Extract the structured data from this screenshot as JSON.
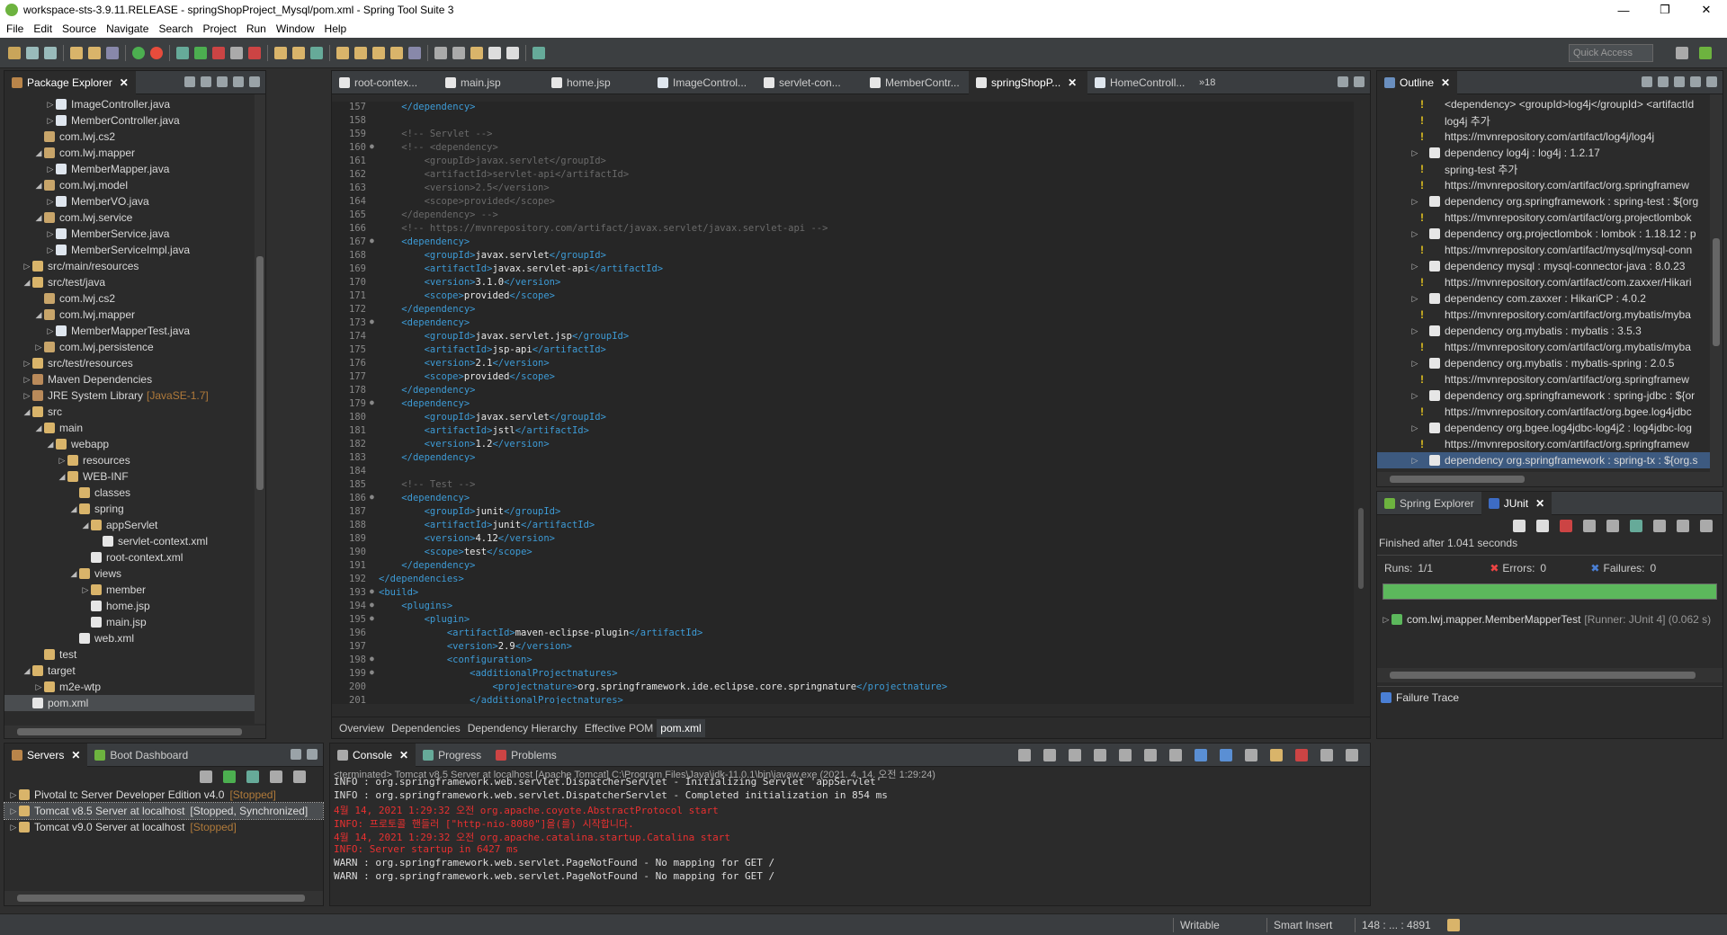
{
  "window": {
    "title": "workspace-sts-3.9.11.RELEASE - springShopProject_Mysql/pom.xml - Spring Tool Suite 3"
  },
  "menu": [
    "File",
    "Edit",
    "Source",
    "Navigate",
    "Search",
    "Project",
    "Run",
    "Window",
    "Help"
  ],
  "toolbar": {
    "quick_access_placeholder": "Quick Access"
  },
  "package_explorer": {
    "title": "Package Explorer",
    "items": [
      {
        "label": "ImageController.java",
        "depth": 3,
        "tw": "▷",
        "icon": "java-file-icon"
      },
      {
        "label": "MemberController.java",
        "depth": 3,
        "tw": "▷",
        "icon": "java-file-icon"
      },
      {
        "label": "com.lwj.cs2",
        "depth": 2,
        "tw": "",
        "icon": "package-icon"
      },
      {
        "label": "com.lwj.mapper",
        "depth": 2,
        "tw": "◢",
        "icon": "package-icon"
      },
      {
        "label": "MemberMapper.java",
        "depth": 3,
        "tw": "▷",
        "icon": "java-file-icon"
      },
      {
        "label": "com.lwj.model",
        "depth": 2,
        "tw": "◢",
        "icon": "package-icon"
      },
      {
        "label": "MemberVO.java",
        "depth": 3,
        "tw": "▷",
        "icon": "java-file-icon"
      },
      {
        "label": "com.lwj.service",
        "depth": 2,
        "tw": "◢",
        "icon": "package-icon"
      },
      {
        "label": "MemberService.java",
        "depth": 3,
        "tw": "▷",
        "icon": "java-file-icon"
      },
      {
        "label": "MemberServiceImpl.java",
        "depth": 3,
        "tw": "▷",
        "icon": "java-file-icon"
      },
      {
        "label": "src/main/resources",
        "depth": 1,
        "tw": "▷",
        "icon": "folder-icon"
      },
      {
        "label": "src/test/java",
        "depth": 1,
        "tw": "◢",
        "icon": "folder-icon"
      },
      {
        "label": "com.lwj.cs2",
        "depth": 2,
        "tw": "",
        "icon": "package-icon"
      },
      {
        "label": "com.lwj.mapper",
        "depth": 2,
        "tw": "◢",
        "icon": "package-icon"
      },
      {
        "label": "MemberMapperTest.java",
        "depth": 3,
        "tw": "▷",
        "icon": "java-file-icon"
      },
      {
        "label": "com.lwj.persistence",
        "depth": 2,
        "tw": "▷",
        "icon": "package-icon"
      },
      {
        "label": "src/test/resources",
        "depth": 1,
        "tw": "▷",
        "icon": "folder-icon"
      },
      {
        "label": "Maven Dependencies",
        "depth": 1,
        "tw": "▷",
        "icon": "library-icon"
      },
      {
        "label": "JRE System Library",
        "suffix": "[JavaSE-1.7]",
        "depth": 1,
        "tw": "▷",
        "icon": "library-icon"
      },
      {
        "label": "src",
        "depth": 1,
        "tw": "◢",
        "icon": "folder-icon"
      },
      {
        "label": "main",
        "depth": 2,
        "tw": "◢",
        "icon": "folder-icon"
      },
      {
        "label": "webapp",
        "depth": 3,
        "tw": "◢",
        "icon": "folder-icon"
      },
      {
        "label": "resources",
        "depth": 4,
        "tw": "▷",
        "icon": "folder-icon"
      },
      {
        "label": "WEB-INF",
        "depth": 4,
        "tw": "◢",
        "icon": "folder-icon"
      },
      {
        "label": "classes",
        "depth": 5,
        "tw": "",
        "icon": "folder-icon"
      },
      {
        "label": "spring",
        "depth": 5,
        "tw": "◢",
        "icon": "folder-icon"
      },
      {
        "label": "appServlet",
        "depth": 6,
        "tw": "◢",
        "icon": "folder-icon"
      },
      {
        "label": "servlet-context.xml",
        "depth": 7,
        "tw": "",
        "icon": "xml-file-icon"
      },
      {
        "label": "root-context.xml",
        "depth": 6,
        "tw": "",
        "icon": "xml-file-icon"
      },
      {
        "label": "views",
        "depth": 5,
        "tw": "◢",
        "icon": "folder-icon"
      },
      {
        "label": "member",
        "depth": 6,
        "tw": "▷",
        "icon": "folder-icon"
      },
      {
        "label": "home.jsp",
        "depth": 6,
        "tw": "",
        "icon": "jsp-file-icon"
      },
      {
        "label": "main.jsp",
        "depth": 6,
        "tw": "",
        "icon": "jsp-file-icon"
      },
      {
        "label": "web.xml",
        "depth": 5,
        "tw": "",
        "icon": "xml-file-icon"
      },
      {
        "label": "test",
        "depth": 2,
        "tw": "",
        "icon": "folder-icon"
      },
      {
        "label": "target",
        "depth": 1,
        "tw": "◢",
        "icon": "folder-icon"
      },
      {
        "label": "m2e-wtp",
        "depth": 2,
        "tw": "▷",
        "icon": "folder-icon"
      },
      {
        "label": "pom.xml",
        "depth": 1,
        "tw": "",
        "icon": "xml-file-icon",
        "selected": true
      }
    ]
  },
  "editor": {
    "tabs": [
      "root-contex...",
      "main.jsp",
      "home.jsp",
      "ImageControl...",
      "servlet-con...",
      "MemberContr...",
      "springShopP...",
      "HomeControll..."
    ],
    "active_tab": "springShopP...",
    "overflow": "»18",
    "lines": [
      {
        "n": "157",
        "f": "",
        "h": "    <span class=t>&lt;/dependency&gt;</span>"
      },
      {
        "n": "158",
        "f": "",
        "h": ""
      },
      {
        "n": "159",
        "f": "",
        "h": "    <span class=cmt>&lt;!-- Servlet --&gt;</span>"
      },
      {
        "n": "160",
        "f": "●",
        "h": "    <span class=cmt>&lt;!-- &lt;dependency&gt;</span>"
      },
      {
        "n": "161",
        "f": "",
        "h": "        <span class=cmt>&lt;groupId&gt;javax.servlet&lt;/groupId&gt;</span>"
      },
      {
        "n": "162",
        "f": "",
        "h": "        <span class=cmt>&lt;artifactId&gt;servlet-api&lt;/artifactId&gt;</span>"
      },
      {
        "n": "163",
        "f": "",
        "h": "        <span class=cmt>&lt;version&gt;2.5&lt;/version&gt;</span>"
      },
      {
        "n": "164",
        "f": "",
        "h": "        <span class=cmt>&lt;scope&gt;provided&lt;/scope&gt;</span>"
      },
      {
        "n": "165",
        "f": "",
        "h": "    <span class=cmt>&lt;/dependency&gt; --&gt;</span>"
      },
      {
        "n": "166",
        "f": "",
        "h": "    <span class=cmt>&lt;!-- https://mvnrepository.com/artifact/javax.servlet/javax.servlet-api --&gt;</span>"
      },
      {
        "n": "167",
        "f": "●",
        "h": "    <span class=t>&lt;dependency&gt;</span>"
      },
      {
        "n": "168",
        "f": "",
        "h": "        <span class=t>&lt;groupId&gt;</span><span class=tx>javax.servlet</span><span class=t>&lt;/groupId&gt;</span>"
      },
      {
        "n": "169",
        "f": "",
        "h": "        <span class=t>&lt;artifactId&gt;</span><span class=tx>javax.servlet-api</span><span class=t>&lt;/artifactId&gt;</span>"
      },
      {
        "n": "170",
        "f": "",
        "h": "        <span class=t>&lt;version&gt;</span><span class=tx>3.1.0</span><span class=t>&lt;/version&gt;</span>"
      },
      {
        "n": "171",
        "f": "",
        "h": "        <span class=t>&lt;scope&gt;</span><span class=tx>provided</span><span class=t>&lt;/scope&gt;</span>"
      },
      {
        "n": "172",
        "f": "",
        "h": "    <span class=t>&lt;/dependency&gt;</span>"
      },
      {
        "n": "173",
        "f": "●",
        "h": "    <span class=t>&lt;dependency&gt;</span>"
      },
      {
        "n": "174",
        "f": "",
        "h": "        <span class=t>&lt;groupId&gt;</span><span class=tx>javax.servlet.jsp</span><span class=t>&lt;/groupId&gt;</span>"
      },
      {
        "n": "175",
        "f": "",
        "h": "        <span class=t>&lt;artifactId&gt;</span><span class=tx>jsp-api</span><span class=t>&lt;/artifactId&gt;</span>"
      },
      {
        "n": "176",
        "f": "",
        "h": "        <span class=t>&lt;version&gt;</span><span class=tx>2.1</span><span class=t>&lt;/version&gt;</span>"
      },
      {
        "n": "177",
        "f": "",
        "h": "        <span class=t>&lt;scope&gt;</span><span class=tx>provided</span><span class=t>&lt;/scope&gt;</span>"
      },
      {
        "n": "178",
        "f": "",
        "h": "    <span class=t>&lt;/dependency&gt;</span>"
      },
      {
        "n": "179",
        "f": "●",
        "h": "    <span class=t>&lt;dependency&gt;</span>"
      },
      {
        "n": "180",
        "f": "",
        "h": "        <span class=t>&lt;groupId&gt;</span><span class=tx>javax.servlet</span><span class=t>&lt;/groupId&gt;</span>"
      },
      {
        "n": "181",
        "f": "",
        "h": "        <span class=t>&lt;artifactId&gt;</span><span class=tx>jstl</span><span class=t>&lt;/artifactId&gt;</span>"
      },
      {
        "n": "182",
        "f": "",
        "h": "        <span class=t>&lt;version&gt;</span><span class=tx>1.2</span><span class=t>&lt;/version&gt;</span>"
      },
      {
        "n": "183",
        "f": "",
        "h": "    <span class=t>&lt;/dependency&gt;</span>"
      },
      {
        "n": "184",
        "f": "",
        "h": ""
      },
      {
        "n": "185",
        "f": "",
        "h": "    <span class=cmt>&lt;!-- Test --&gt;</span>"
      },
      {
        "n": "186",
        "f": "●",
        "h": "    <span class=t>&lt;dependency&gt;</span>"
      },
      {
        "n": "187",
        "f": "",
        "h": "        <span class=t>&lt;groupId&gt;</span><span class=tx>junit</span><span class=t>&lt;/groupId&gt;</span>"
      },
      {
        "n": "188",
        "f": "",
        "h": "        <span class=t>&lt;artifactId&gt;</span><span class=tx>junit</span><span class=t>&lt;/artifactId&gt;</span>"
      },
      {
        "n": "189",
        "f": "",
        "h": "        <span class=t>&lt;version&gt;</span><span class=tx>4.12</span><span class=t>&lt;/version&gt;</span>"
      },
      {
        "n": "190",
        "f": "",
        "h": "        <span class=t>&lt;scope&gt;</span><span class=tx>test</span><span class=t>&lt;/scope&gt;</span>"
      },
      {
        "n": "191",
        "f": "",
        "h": "    <span class=t>&lt;/dependency&gt;</span>"
      },
      {
        "n": "192",
        "f": "",
        "h": "<span class=t>&lt;/dependencies&gt;</span>"
      },
      {
        "n": "193",
        "f": "●",
        "h": "<span class=t>&lt;build&gt;</span>"
      },
      {
        "n": "194",
        "f": "●",
        "h": "    <span class=t>&lt;plugins&gt;</span>"
      },
      {
        "n": "195",
        "f": "●",
        "h": "        <span class=t>&lt;plugin&gt;</span>"
      },
      {
        "n": "196",
        "f": "",
        "h": "            <span class=t>&lt;artifactId&gt;</span><span class=tx>maven-eclipse-plugin</span><span class=t>&lt;/artifactId&gt;</span>"
      },
      {
        "n": "197",
        "f": "",
        "h": "            <span class=t>&lt;version&gt;</span><span class=tx>2.9</span><span class=t>&lt;/version&gt;</span>"
      },
      {
        "n": "198",
        "f": "●",
        "h": "            <span class=t>&lt;configuration&gt;</span>"
      },
      {
        "n": "199",
        "f": "●",
        "h": "                <span class=t>&lt;additionalProjectnatures&gt;</span>"
      },
      {
        "n": "200",
        "f": "",
        "h": "                    <span class=t>&lt;projectnature&gt;</span><span class=tx>org.springframework.ide.eclipse.core.springnature</span><span class=t>&lt;/projectnature&gt;</span>"
      },
      {
        "n": "201",
        "f": "",
        "h": "                <span class=t>&lt;/additionalProjectnatures&gt;</span>"
      }
    ],
    "bottom_tabs": [
      "Overview",
      "Dependencies",
      "Dependency Hierarchy",
      "Effective POM",
      "pom.xml"
    ],
    "active_bottom_tab": "pom.xml"
  },
  "outline": {
    "title": "Outline",
    "items": [
      {
        "t": "",
        "bang": true,
        "text": "<dependency> <groupId>log4j</groupId> <artifactId"
      },
      {
        "t": "",
        "bang": true,
        "text": "log4j 추가"
      },
      {
        "t": "",
        "bang": true,
        "text": "https://mvnrepository.com/artifact/log4j/log4j"
      },
      {
        "t": "▷",
        "bang": false,
        "text": "dependency  log4j : log4j : 1.2.17"
      },
      {
        "t": "",
        "bang": true,
        "text": "spring-test 추가"
      },
      {
        "t": "",
        "bang": true,
        "text": "https://mvnrepository.com/artifact/org.springframew"
      },
      {
        "t": "▷",
        "bang": false,
        "text": "dependency  org.springframework : spring-test : ${org"
      },
      {
        "t": "",
        "bang": true,
        "text": "https://mvnrepository.com/artifact/org.projectlombok"
      },
      {
        "t": "▷",
        "bang": false,
        "text": "dependency  org.projectlombok : lombok : 1.18.12 : p"
      },
      {
        "t": "",
        "bang": true,
        "text": "https://mvnrepository.com/artifact/mysql/mysql-conn"
      },
      {
        "t": "▷",
        "bang": false,
        "text": "dependency  mysql : mysql-connector-java : 8.0.23"
      },
      {
        "t": "",
        "bang": true,
        "text": "https://mvnrepository.com/artifact/com.zaxxer/Hikari"
      },
      {
        "t": "▷",
        "bang": false,
        "text": "dependency  com.zaxxer : HikariCP : 4.0.2"
      },
      {
        "t": "",
        "bang": true,
        "text": "https://mvnrepository.com/artifact/org.mybatis/myba"
      },
      {
        "t": "▷",
        "bang": false,
        "text": "dependency  org.mybatis : mybatis : 3.5.3"
      },
      {
        "t": "",
        "bang": true,
        "text": "https://mvnrepository.com/artifact/org.mybatis/myba"
      },
      {
        "t": "▷",
        "bang": false,
        "text": "dependency  org.mybatis : mybatis-spring : 2.0.5"
      },
      {
        "t": "",
        "bang": true,
        "text": "https://mvnrepository.com/artifact/org.springframew"
      },
      {
        "t": "▷",
        "bang": false,
        "text": "dependency  org.springframework : spring-jdbc : ${or"
      },
      {
        "t": "",
        "bang": true,
        "text": "https://mvnrepository.com/artifact/org.bgee.log4jdbc"
      },
      {
        "t": "▷",
        "bang": false,
        "text": "dependency  org.bgee.log4jdbc-log4j2 : log4jdbc-log"
      },
      {
        "t": "",
        "bang": true,
        "text": "https://mvnrepository.com/artifact/org.springframew"
      },
      {
        "t": "▷",
        "bang": false,
        "text": "dependency  org.springframework : spring-tx : ${org.s",
        "selected": true
      }
    ]
  },
  "junit": {
    "tabs": [
      "Spring Explorer",
      "JUnit"
    ],
    "finished": "Finished after 1.041 seconds",
    "runs_label": "Runs:",
    "runs": "1/1",
    "errors_label": "Errors:",
    "errors": "0",
    "failures_label": "Failures:",
    "failures": "0",
    "progress": 1.0,
    "test_name": "com.lwj.mapper.MemberMapperTest",
    "test_runner": "[Runner: JUnit 4] (0.062 s)",
    "failure_trace": "Failure Trace"
  },
  "servers": {
    "tabs": [
      "Servers",
      "Boot Dashboard"
    ],
    "items": [
      {
        "name": "Pivotal tc Server Developer Edition v4.0",
        "state": "[Stopped]",
        "selected": false
      },
      {
        "name": "Tomcat v8.5 Server at localhost",
        "state": "[Stopped, Synchronized]",
        "selected": true
      },
      {
        "name": "Tomcat v9.0 Server at localhost",
        "state": "[Stopped]",
        "selected": false
      }
    ]
  },
  "console": {
    "tabs": [
      "Console",
      "Progress",
      "Problems"
    ],
    "header": "<terminated> Tomcat v8.5 Server at localhost [Apache Tomcat] C:\\Program Files\\Java\\jdk-11.0.1\\bin\\javaw.exe (2021. 4. 14. 오전 1:29:24)",
    "lines": [
      {
        "text": "INFO : org.springframework.web.servlet.DispatcherServlet - Initializing Servlet 'appServlet'",
        "red": false
      },
      {
        "text": "INFO : org.springframework.web.servlet.DispatcherServlet - Completed initialization in 854 ms",
        "red": false
      },
      {
        "text": "4월 14, 2021 1:29:32 오전 org.apache.coyote.AbstractProtocol start",
        "red": true
      },
      {
        "text": "INFO: 프로토콜 핸들러 [\"http-nio-8080\"]을(를) 시작합니다.",
        "red": true
      },
      {
        "text": "4월 14, 2021 1:29:32 오전 org.apache.catalina.startup.Catalina start",
        "red": true
      },
      {
        "text": "INFO: Server startup in 6427 ms",
        "red": true
      },
      {
        "text": "WARN : org.springframework.web.servlet.PageNotFound - No mapping for GET /",
        "red": false
      },
      {
        "text": "WARN : org.springframework.web.servlet.PageNotFound - No mapping for GET /",
        "red": false
      }
    ]
  },
  "status": {
    "writable": "Writable",
    "insert": "Smart Insert",
    "position": "148 : ... : 4891"
  },
  "colors": {
    "accent_green": "#5cb85c",
    "error_red": "#e83030",
    "tag_blue": "#3d9bd6"
  }
}
